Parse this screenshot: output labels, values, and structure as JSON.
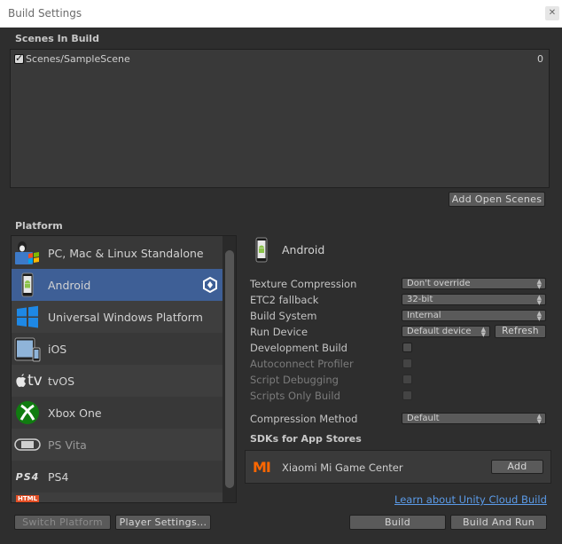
{
  "window": {
    "title": "Build Settings",
    "close_glyph": "✕"
  },
  "scenes": {
    "header": "Scenes In Build",
    "items": [
      {
        "name": "Scenes/SampleScene",
        "index": "0",
        "checked": true
      }
    ],
    "add_open_scenes_label": "Add Open Scenes"
  },
  "platform": {
    "header": "Platform",
    "items": [
      {
        "label": "PC, Mac & Linux Standalone",
        "icon": "pc-mac-linux-icon"
      },
      {
        "label": "Android",
        "icon": "android-icon",
        "selected": true
      },
      {
        "label": "Universal Windows Platform",
        "icon": "windows-icon"
      },
      {
        "label": "iOS",
        "icon": "ios-icon"
      },
      {
        "label": "tvOS",
        "icon": "appletv-icon",
        "icon_text": "tv"
      },
      {
        "label": "Xbox One",
        "icon": "xbox-icon"
      },
      {
        "label": "PS Vita",
        "icon": "psvita-icon"
      },
      {
        "label": "PS4",
        "icon": "ps4-icon",
        "icon_text": "PS4"
      },
      {
        "label": "",
        "icon": "html5-icon",
        "icon_text": "HTML"
      }
    ]
  },
  "settings": {
    "platform_title": "Android",
    "texture_compression": {
      "label": "Texture Compression",
      "value": "Don't override"
    },
    "etc2_fallback": {
      "label": "ETC2 fallback",
      "value": "32-bit"
    },
    "build_system": {
      "label": "Build System",
      "value": "Internal"
    },
    "run_device": {
      "label": "Run Device",
      "value": "Default device",
      "refresh_label": "Refresh"
    },
    "development_build": {
      "label": "Development Build"
    },
    "autoconnect_profiler": {
      "label": "Autoconnect Profiler"
    },
    "script_debugging": {
      "label": "Script Debugging"
    },
    "scripts_only_build": {
      "label": "Scripts Only Build"
    },
    "compression_method": {
      "label": "Compression Method",
      "value": "Default"
    }
  },
  "sdks": {
    "header": "SDKs for App Stores",
    "items": [
      {
        "name": "Xiaomi Mi Game Center",
        "add_label": "Add",
        "icon": "xiaomi-icon",
        "icon_text": "MI"
      }
    ]
  },
  "footer": {
    "cloud_link": "Learn about Unity Cloud Build",
    "switch_platform": "Switch Platform",
    "player_settings": "Player Settings...",
    "build": "Build",
    "build_and_run": "Build And Run"
  },
  "colors": {
    "selection": "#3e5f96",
    "link": "#5b9be8",
    "xiaomi": "#ff6700",
    "xbox": "#107c10",
    "windows": "#1e88e5"
  }
}
